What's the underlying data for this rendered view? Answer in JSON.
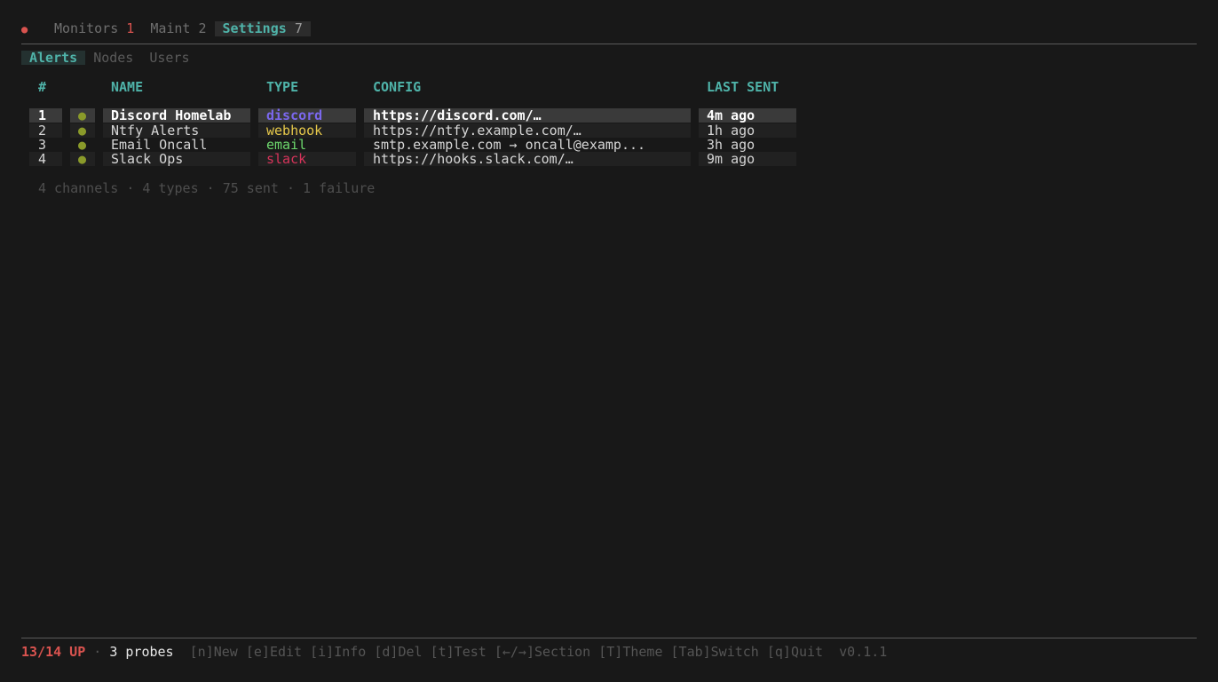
{
  "topbar": {
    "status_icon": "red-dot-icon",
    "tabs": [
      {
        "label": "Monitors",
        "count": "1"
      },
      {
        "label": "Maint",
        "count": "2"
      },
      {
        "label": "Settings",
        "count": "7"
      }
    ]
  },
  "subtabs": [
    "Alerts",
    "Nodes",
    "Users"
  ],
  "table": {
    "headers": {
      "num": "#",
      "name": "NAME",
      "type": "TYPE",
      "config": "CONFIG",
      "last_sent": "LAST SENT"
    },
    "rows": [
      {
        "num": "1",
        "status": "●",
        "name": "Discord Homelab",
        "type": "discord",
        "config": "https://discord.com/…",
        "last_sent": "4m ago"
      },
      {
        "num": "2",
        "status": "●",
        "name": "Ntfy Alerts",
        "type": "webhook",
        "config": "https://ntfy.example.com/…",
        "last_sent": "1h ago"
      },
      {
        "num": "3",
        "status": "●",
        "name": "Email Oncall",
        "type": "email",
        "config": "smtp.example.com → oncall@examp...",
        "last_sent": "3h ago"
      },
      {
        "num": "4",
        "status": "●",
        "name": "Slack Ops",
        "type": "slack",
        "config": "https://hooks.slack.com/…",
        "last_sent": "9m ago"
      }
    ]
  },
  "summary": "4 channels · 4 types · 75 sent · 1 failure",
  "footer": {
    "up": "13/14 UP",
    "sep": "·",
    "probes": "3 probes",
    "keys": "[n]New [e]Edit [i]Info [d]Del [t]Test [←/→]Section [T]Theme [Tab]Switch [q]Quit",
    "version": "v0.1.1"
  },
  "colors": {
    "accent": "#4fb3a9",
    "error": "#d9534f",
    "discord": "#7b68ee",
    "webhook": "#e6c84a",
    "email": "#6dd86d",
    "slack": "#d6335a"
  }
}
